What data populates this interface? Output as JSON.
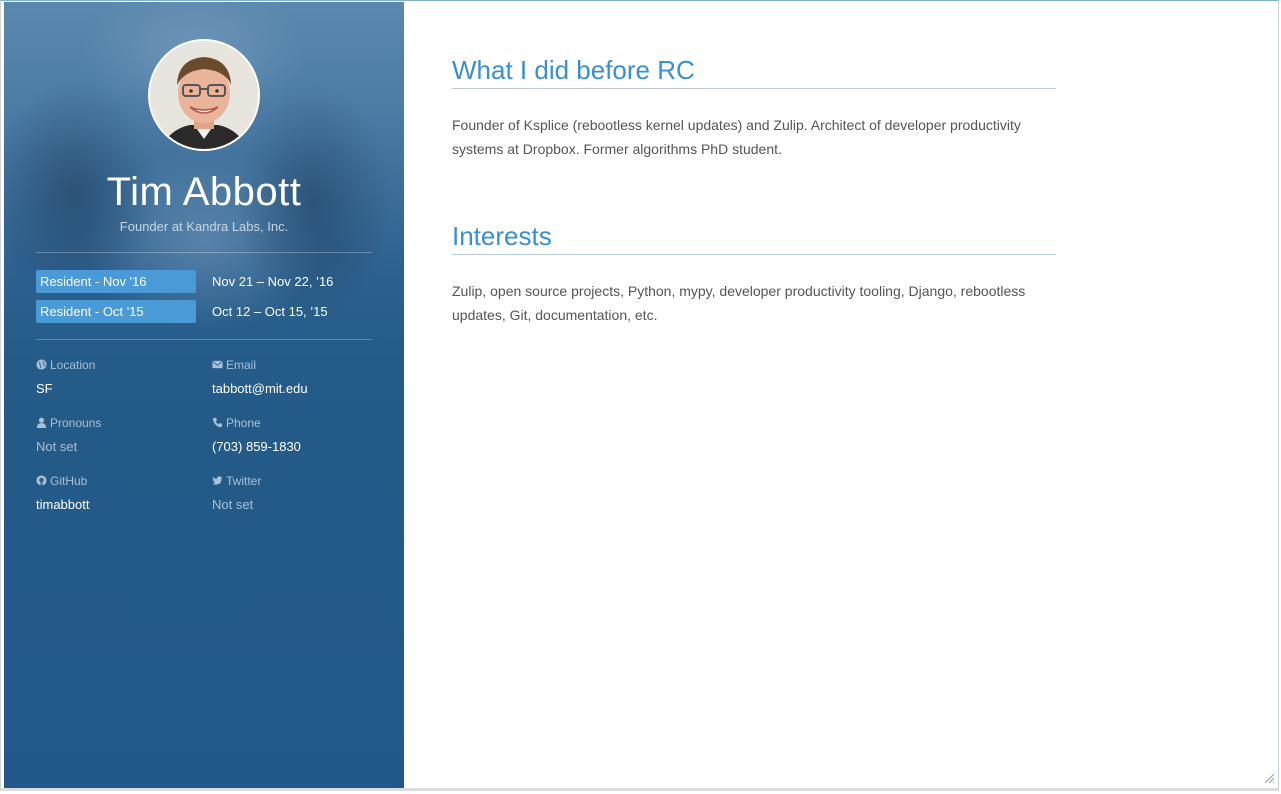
{
  "profile": {
    "name": "Tim Abbott",
    "subtitle": "Founder at Kandra Labs, Inc."
  },
  "batches": [
    {
      "label": "Resident - Nov '16",
      "dates": "Nov 21 – Nov 22, ’16"
    },
    {
      "label": "Resident - Oct '15",
      "dates": "Oct 12 – Oct 15, ’15"
    }
  ],
  "details": {
    "location": {
      "label": "Location",
      "value": "SF",
      "icon": "globe-icon"
    },
    "email": {
      "label": "Email",
      "value": "tabbott@mit.edu",
      "icon": "envelope-icon"
    },
    "pronouns": {
      "label": "Pronouns",
      "value": "Not set",
      "icon": "user-icon"
    },
    "phone": {
      "label": "Phone",
      "value": "(703) 859-1830",
      "icon": "phone-icon"
    },
    "github": {
      "label": "GitHub",
      "value": "timabbott",
      "icon": "github-icon"
    },
    "twitter": {
      "label": "Twitter",
      "value": "Not set",
      "icon": "twitter-icon"
    }
  },
  "sections": [
    {
      "title": "What I did before RC",
      "body": "Founder of Ksplice (rebootless kernel updates) and Zulip. Architect of developer productivity systems at Dropbox. Former algorithms PhD student."
    },
    {
      "title": "Interests",
      "body": "Zulip, open source projects, Python, mypy, developer productivity tooling, Django, rebootless updates, Git, documentation, etc."
    }
  ],
  "colors": {
    "accent": "#3b8fcf",
    "badge": "#4a9ad8",
    "sidebar": "#22578a"
  }
}
